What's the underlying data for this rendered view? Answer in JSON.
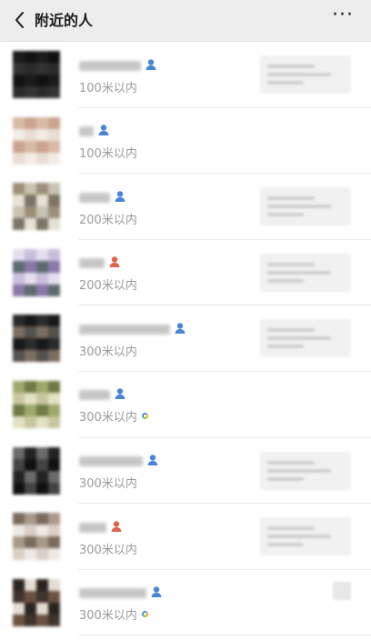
{
  "header": {
    "title": "附近的人",
    "back_icon": "back-chevron-icon",
    "more_icon": "more-ellipsis-icon",
    "more_glyph": "···",
    "background": "#ededed"
  },
  "people": [
    {
      "distance": "100米以内",
      "gender": "male",
      "status_dot": false,
      "snippet": true
    },
    {
      "distance": "100米以内",
      "gender": "male",
      "status_dot": false,
      "snippet": false
    },
    {
      "distance": "200米以内",
      "gender": "male",
      "status_dot": false,
      "snippet": true
    },
    {
      "distance": "200米以内",
      "gender": "female",
      "status_dot": false,
      "snippet": true
    },
    {
      "distance": "300米以内",
      "gender": "male",
      "status_dot": false,
      "snippet": true
    },
    {
      "distance": "300米以内",
      "gender": "male",
      "status_dot": true,
      "snippet": false
    },
    {
      "distance": "300米以内",
      "gender": "male",
      "status_dot": false,
      "snippet": true
    },
    {
      "distance": "300米以内",
      "gender": "female",
      "status_dot": false,
      "snippet": true
    },
    {
      "distance": "300米以内",
      "gender": "male",
      "status_dot": true,
      "snippet": false
    }
  ],
  "colors": {
    "male_icon": "#4a86d8",
    "female_icon": "#e0644a",
    "distance_text": "#9b9b9b",
    "divider": "#ececec"
  }
}
